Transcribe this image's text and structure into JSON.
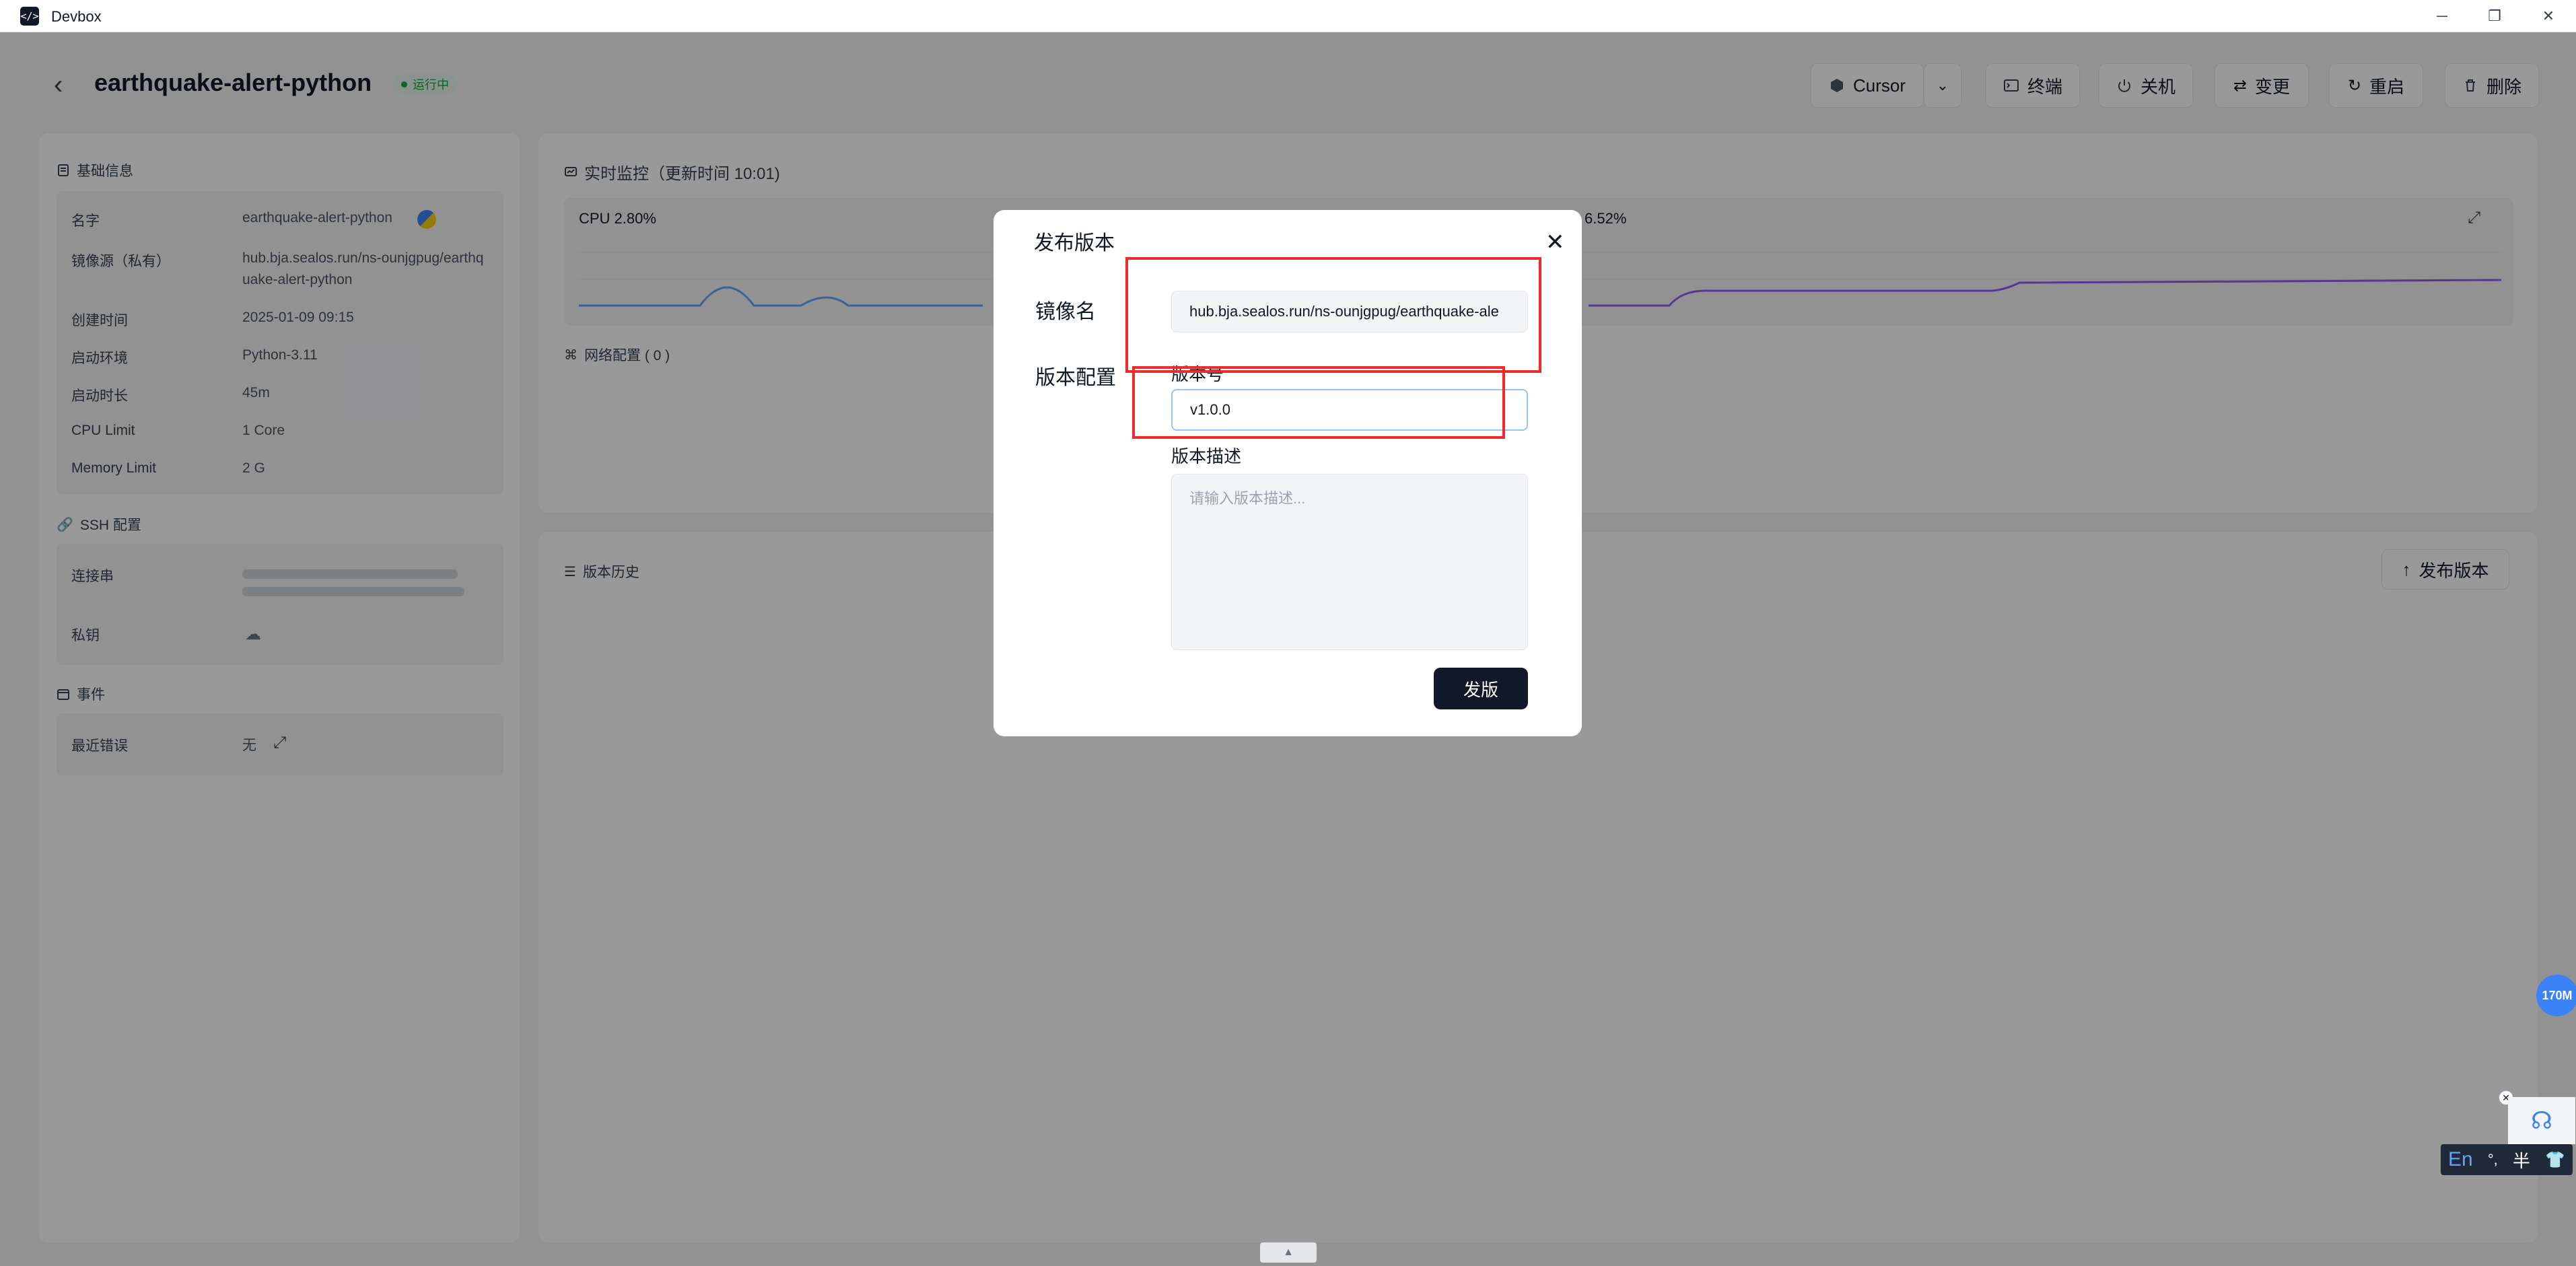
{
  "window": {
    "title": "Devbox",
    "icon": "devbox-app-icon"
  },
  "header": {
    "title": "earthquake-alert-python",
    "status": "运行中",
    "ide": "Cursor",
    "actions": {
      "terminal": "终端",
      "shutdown": "关机",
      "change": "变更",
      "restart": "重启",
      "delete": "删除"
    }
  },
  "basic_info": {
    "heading": "基础信息",
    "rows": [
      {
        "label": "名字",
        "value": "earthquake-alert-python"
      },
      {
        "label": "镜像源（私有）",
        "value": "hub.bja.sealos.run/ns-ounjgpug/earthquake-alert-python"
      },
      {
        "label": "创建时间",
        "value": "2025-01-09 09:15"
      },
      {
        "label": "启动环境",
        "value": "Python-3.11"
      },
      {
        "label": "启动时长",
        "value": "45m"
      },
      {
        "label": "CPU Limit",
        "value": "1 Core"
      },
      {
        "label": "Memory Limit",
        "value": "2 G"
      }
    ]
  },
  "ssh": {
    "heading": "SSH 配置",
    "conn_label": "连接串",
    "key_label": "私钥"
  },
  "events": {
    "heading": "事件",
    "last_error_label": "最近错误",
    "last_error_value": "无"
  },
  "monitor": {
    "heading": "实时监控（更新时间 10:01)",
    "cpu": "CPU 2.80%",
    "mem_partial": "6.52%",
    "network": "网络配置 ( 0 )"
  },
  "history": {
    "heading": "版本历史",
    "publish_button": "发布版本"
  },
  "modal": {
    "title": "发布版本",
    "image_label": "镜像名",
    "image_value": "hub.bja.sealos.run/ns-ounjgpug/earthquake-ale",
    "config_label": "版本配置",
    "version_label": "版本号",
    "version_value": "v1.0.0",
    "desc_label": "版本描述",
    "desc_placeholder": "请输入版本描述...",
    "submit": "发版"
  },
  "widgets": {
    "mem_badge": "170M",
    "ime_lang": "En",
    "ime_punct": "°,",
    "ime_width": "半"
  },
  "colors": {
    "accent": "#111827",
    "status_green": "#16a34a",
    "annotation_red": "#ef2b2b",
    "focus_blue": "#93c5fd"
  }
}
